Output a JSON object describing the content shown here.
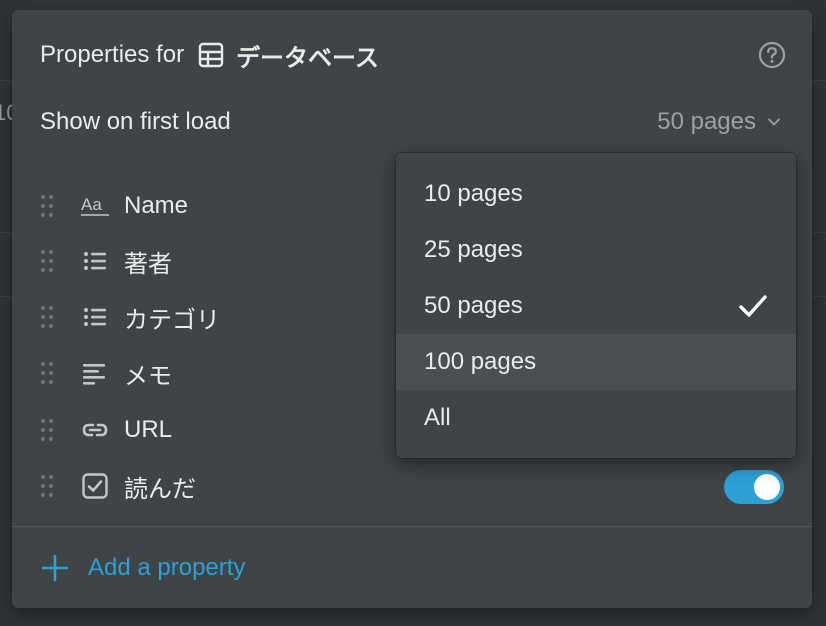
{
  "background": {
    "partial_text": "10"
  },
  "panel": {
    "title_prefix": "Properties for",
    "database_name": "データベース",
    "database_icon": "table-icon",
    "help_icon": "question-circle-icon"
  },
  "first_load": {
    "label": "Show on first load",
    "value": "50 pages"
  },
  "properties": [
    {
      "name": "Name",
      "icon": "text-icon"
    },
    {
      "name": "著者",
      "icon": "list-icon"
    },
    {
      "name": "カテゴリ",
      "icon": "list-icon"
    },
    {
      "name": "メモ",
      "icon": "paragraph-icon"
    },
    {
      "name": "URL",
      "icon": "link-icon"
    },
    {
      "name": "読んだ",
      "icon": "checkbox-icon",
      "visible": true
    }
  ],
  "add_property": {
    "label": "Add a property"
  },
  "dropdown": {
    "options": [
      "10 pages",
      "25 pages",
      "50 pages",
      "100 pages",
      "All"
    ],
    "selected": "50 pages",
    "hovered": "100 pages"
  },
  "colors": {
    "accent": "#2ea0d6",
    "panel": "#3f4447",
    "background": "#2f3437"
  }
}
